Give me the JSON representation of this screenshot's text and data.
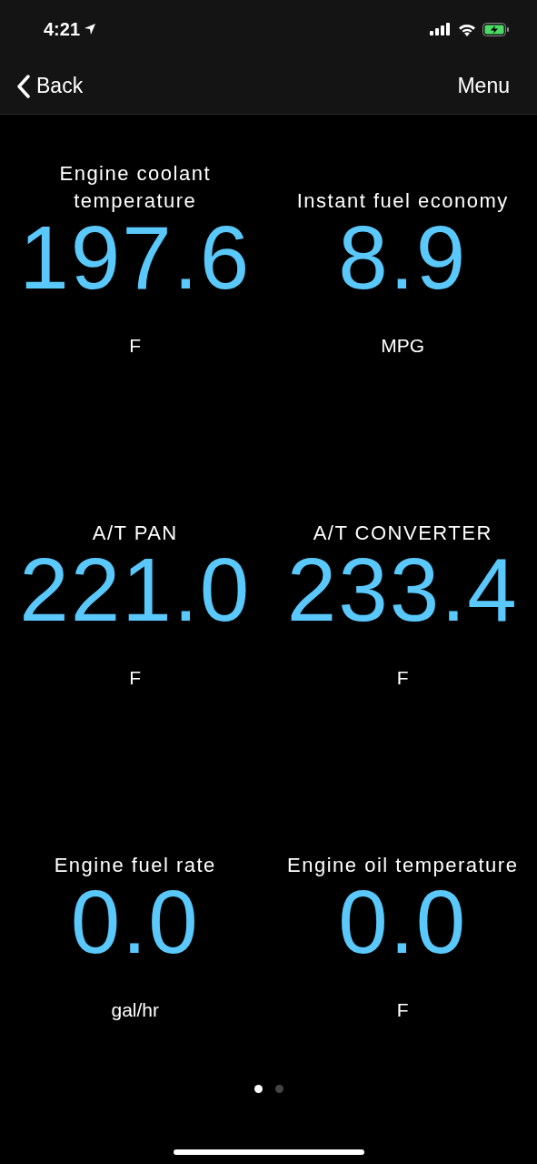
{
  "status_bar": {
    "time": "4:21"
  },
  "nav": {
    "back": "Back",
    "menu": "Menu"
  },
  "gauges": [
    {
      "title": "Engine coolant temperature",
      "value": "197.6",
      "unit": "F"
    },
    {
      "title": "Instant fuel economy",
      "value": "8.9",
      "unit": "MPG"
    },
    {
      "title": "A/T PAN",
      "value": "221.0",
      "unit": "F"
    },
    {
      "title": "A/T CONVERTER",
      "value": "233.4",
      "unit": "F"
    },
    {
      "title": "Engine fuel rate",
      "value": "0.0",
      "unit": "gal/hr"
    },
    {
      "title": "Engine oil temperature",
      "value": "0.0",
      "unit": "F"
    }
  ],
  "pages": [
    {
      "selected": true
    },
    {
      "selected": false
    }
  ]
}
